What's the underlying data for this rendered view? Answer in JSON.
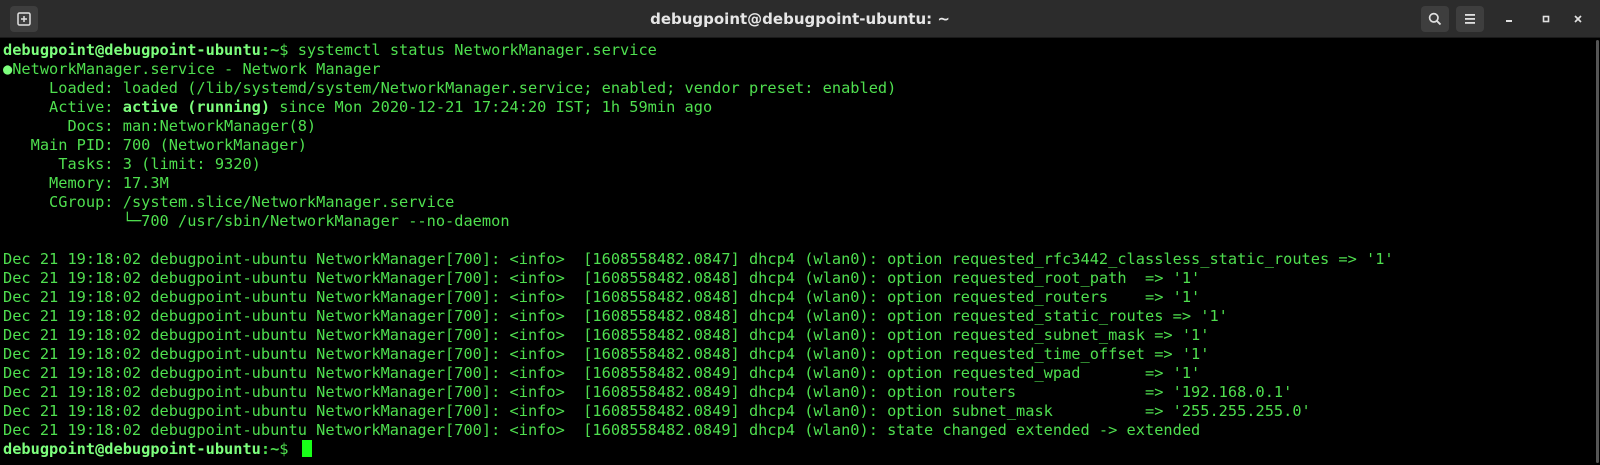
{
  "window": {
    "title": "debugpoint@debugpoint-ubuntu: ~"
  },
  "icons": {
    "new_tab": "new-tab-icon",
    "search": "search-icon",
    "menu": "hamburger-menu-icon",
    "minimize": "minimize-icon",
    "maximize": "maximize-icon",
    "close": "close-icon"
  },
  "colors": {
    "terminal_bg": "#000000",
    "terminal_fg": "#4fdf4f",
    "terminal_bright": "#7dff7d",
    "cursor": "#18ff18",
    "titlebar_bg": "#2c2c2c"
  },
  "prompt": {
    "user_host": "debugpoint@debugpoint-ubuntu",
    "path": ":~",
    "symbol": "$ ",
    "command": "systemctl status NetworkManager.service"
  },
  "status": {
    "dot": "●",
    "header": "NetworkManager.service - Network Manager",
    "loaded_label": "     Loaded: ",
    "loaded_value": "loaded (/lib/systemd/system/NetworkManager.service; enabled; vendor preset: enabled)",
    "active_label": "     Active: ",
    "active_state": "active (running)",
    "active_since": " since Mon 2020-12-21 17:24:20 IST; 1h 59min ago",
    "docs_label": "       Docs: ",
    "docs_value": "man:NetworkManager(8)",
    "pid_label": "   Main PID: ",
    "pid_value": "700 (NetworkManager)",
    "tasks_label": "      Tasks: ",
    "tasks_value": "3 (limit: 9320)",
    "memory_label": "     Memory: ",
    "memory_value": "17.3M",
    "cgroup_label": "     CGroup: ",
    "cgroup_value": "/system.slice/NetworkManager.service",
    "cgroup_child": "             └─700 /usr/sbin/NetworkManager --no-daemon"
  },
  "log_lines": [
    "Dec 21 19:18:02 debugpoint-ubuntu NetworkManager[700]: <info>  [1608558482.0847] dhcp4 (wlan0): option requested_rfc3442_classless_static_routes => '1'",
    "Dec 21 19:18:02 debugpoint-ubuntu NetworkManager[700]: <info>  [1608558482.0848] dhcp4 (wlan0): option requested_root_path  => '1'",
    "Dec 21 19:18:02 debugpoint-ubuntu NetworkManager[700]: <info>  [1608558482.0848] dhcp4 (wlan0): option requested_routers    => '1'",
    "Dec 21 19:18:02 debugpoint-ubuntu NetworkManager[700]: <info>  [1608558482.0848] dhcp4 (wlan0): option requested_static_routes => '1'",
    "Dec 21 19:18:02 debugpoint-ubuntu NetworkManager[700]: <info>  [1608558482.0848] dhcp4 (wlan0): option requested_subnet_mask => '1'",
    "Dec 21 19:18:02 debugpoint-ubuntu NetworkManager[700]: <info>  [1608558482.0848] dhcp4 (wlan0): option requested_time_offset => '1'",
    "Dec 21 19:18:02 debugpoint-ubuntu NetworkManager[700]: <info>  [1608558482.0849] dhcp4 (wlan0): option requested_wpad       => '1'",
    "Dec 21 19:18:02 debugpoint-ubuntu NetworkManager[700]: <info>  [1608558482.0849] dhcp4 (wlan0): option routers              => '192.168.0.1'",
    "Dec 21 19:18:02 debugpoint-ubuntu NetworkManager[700]: <info>  [1608558482.0849] dhcp4 (wlan0): option subnet_mask          => '255.255.255.0'",
    "Dec 21 19:18:02 debugpoint-ubuntu NetworkManager[700]: <info>  [1608558482.0849] dhcp4 (wlan0): state changed extended -> extended"
  ]
}
